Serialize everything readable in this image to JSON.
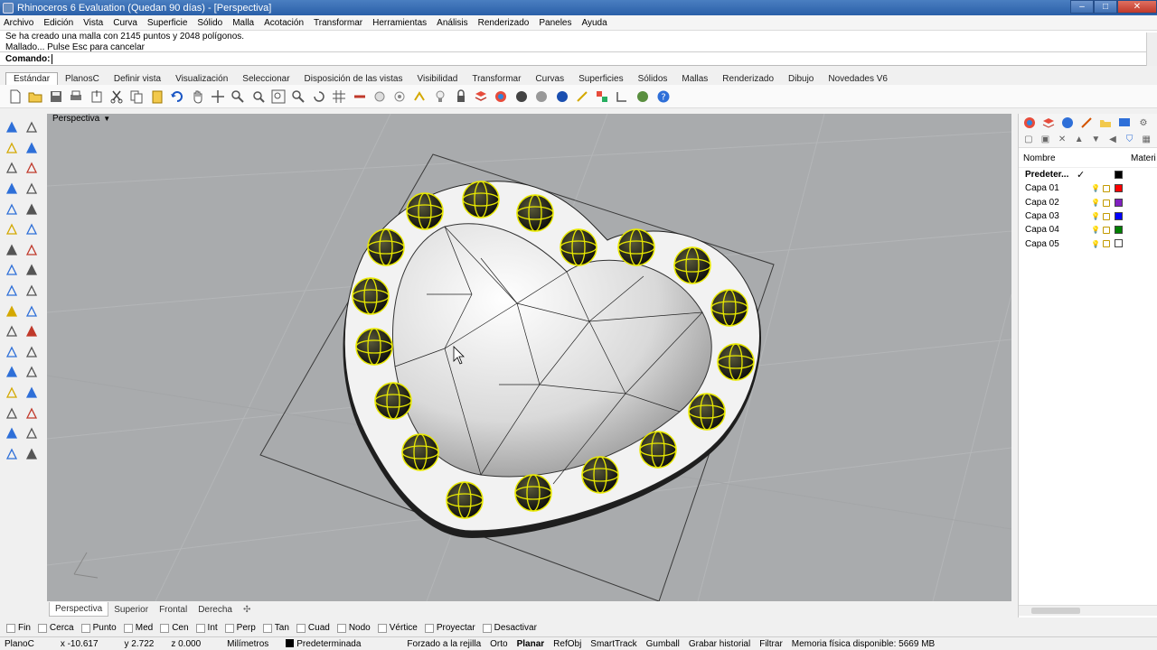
{
  "window": {
    "title": "Rhinoceros 6 Evaluation (Quedan 90 días) - [Perspectiva]"
  },
  "menu": [
    "Archivo",
    "Edición",
    "Vista",
    "Curva",
    "Superficie",
    "Sólido",
    "Malla",
    "Acotación",
    "Transformar",
    "Herramientas",
    "Análisis",
    "Renderizado",
    "Paneles",
    "Ayuda"
  ],
  "command_history": {
    "line1": "Se ha creado una malla con 2145 puntos y 2048 polígonos.",
    "line2": "Mallado... Pulse Esc para cancelar"
  },
  "command_prompt": {
    "label": "Comando:",
    "value": ""
  },
  "toolbar_tabs": [
    "Estándar",
    "PlanosC",
    "Definir vista",
    "Visualización",
    "Seleccionar",
    "Disposición de las vistas",
    "Visibilidad",
    "Transformar",
    "Curvas",
    "Superficies",
    "Sólidos",
    "Mallas",
    "Renderizado",
    "Dibujo",
    "Novedades V6"
  ],
  "active_toolbar_tab": "Estándar",
  "viewport": {
    "label": "Perspectiva"
  },
  "viewport_tabs": [
    "Perspectiva",
    "Superior",
    "Frontal",
    "Derecha"
  ],
  "layers_panel": {
    "col_name": "Nombre",
    "col_material": "Materi",
    "layers": [
      {
        "name": "Predeter...",
        "color": "#000000",
        "current": true
      },
      {
        "name": "Capa 01",
        "color": "#ff0000"
      },
      {
        "name": "Capa 02",
        "color": "#8020c0"
      },
      {
        "name": "Capa 03",
        "color": "#0000ff"
      },
      {
        "name": "Capa 04",
        "color": "#008000"
      },
      {
        "name": "Capa 05",
        "color": "#ffffff"
      }
    ]
  },
  "osnaps": [
    "Fin",
    "Cerca",
    "Punto",
    "Med",
    "Cen",
    "Int",
    "Perp",
    "Tan",
    "Cuad",
    "Nodo",
    "Vértice",
    "Proyectar",
    "Desactivar"
  ],
  "status": {
    "cplane": "PlanoC",
    "x": "x -10.617",
    "y": "y 2.722",
    "z": "z 0.000",
    "units": "Milímetros",
    "layer": "Predeterminada",
    "grid_snap": "Forzado a la rejilla",
    "ortho": "Orto",
    "planar": "Planar",
    "osnap": "RefObj",
    "smarttrack": "SmartTrack",
    "gumball": "Gumball",
    "history": "Grabar historial",
    "filter": "Filtrar",
    "memory": "Memoria física disponible: 5669 MB"
  }
}
